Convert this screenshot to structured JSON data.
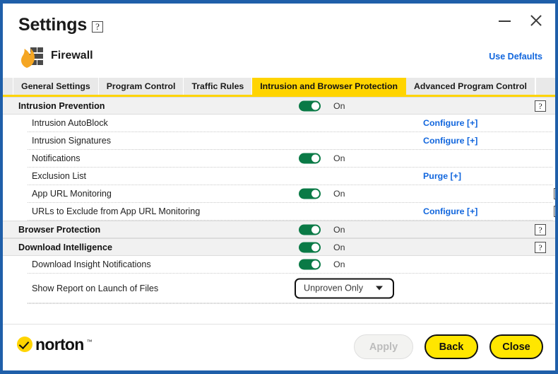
{
  "window": {
    "title": "Settings",
    "title_help_icon": "question-mark-icon",
    "minimize_icon": "minimize-icon",
    "close_icon": "close-icon",
    "border_color": "#1f5fa9"
  },
  "header": {
    "feature_icon": "firewall-flame-wall-icon",
    "feature_title": "Firewall",
    "use_defaults_label": "Use Defaults",
    "link_color": "#1166dd"
  },
  "tabs": [
    {
      "label": "General Settings",
      "active": false
    },
    {
      "label": "Program Control",
      "active": false
    },
    {
      "label": "Traffic Rules",
      "active": false
    },
    {
      "label": "Intrusion and Browser Protection",
      "active": true
    },
    {
      "label": "Advanced Program Control",
      "active": false
    }
  ],
  "tab_active_color": "#ffd400",
  "rows": [
    {
      "label": "Intrusion Prevention",
      "type": "section",
      "toggle": "on",
      "toggle_state": "On",
      "help": "question-mark-icon"
    },
    {
      "label": "Intrusion AutoBlock",
      "type": "sub",
      "link": "Configure [+]"
    },
    {
      "label": "Intrusion Signatures",
      "type": "sub",
      "link": "Configure [+]"
    },
    {
      "label": "Notifications",
      "type": "sub",
      "toggle": "on",
      "toggle_state": "On"
    },
    {
      "label": "Exclusion List",
      "type": "sub",
      "link": "Purge [+]"
    },
    {
      "label": "App URL Monitoring",
      "type": "sub",
      "toggle": "on",
      "toggle_state": "On",
      "help": "question-mark-icon"
    },
    {
      "label": "URLs to Exclude from App URL Monitoring",
      "type": "sub",
      "link": "Configure [+]",
      "help": "question-mark-icon"
    },
    {
      "label": "Browser Protection",
      "type": "section",
      "toggle": "on",
      "toggle_state": "On",
      "help": "question-mark-icon"
    },
    {
      "label": "Download Intelligence",
      "type": "section",
      "toggle": "on",
      "toggle_state": "On",
      "help": "question-mark-icon"
    },
    {
      "label": "Download Insight Notifications",
      "type": "sub",
      "toggle": "on",
      "toggle_state": "On"
    },
    {
      "label": "Show Report on Launch of Files",
      "type": "sub",
      "dropdown_value": "Unproven Only"
    }
  ],
  "toggle_on_color": "#0a7a46",
  "footer": {
    "brand": "norton",
    "brand_tm": "™",
    "brand_accent": "#ffd400",
    "apply_label": "Apply",
    "back_label": "Back",
    "close_label": "Close"
  }
}
